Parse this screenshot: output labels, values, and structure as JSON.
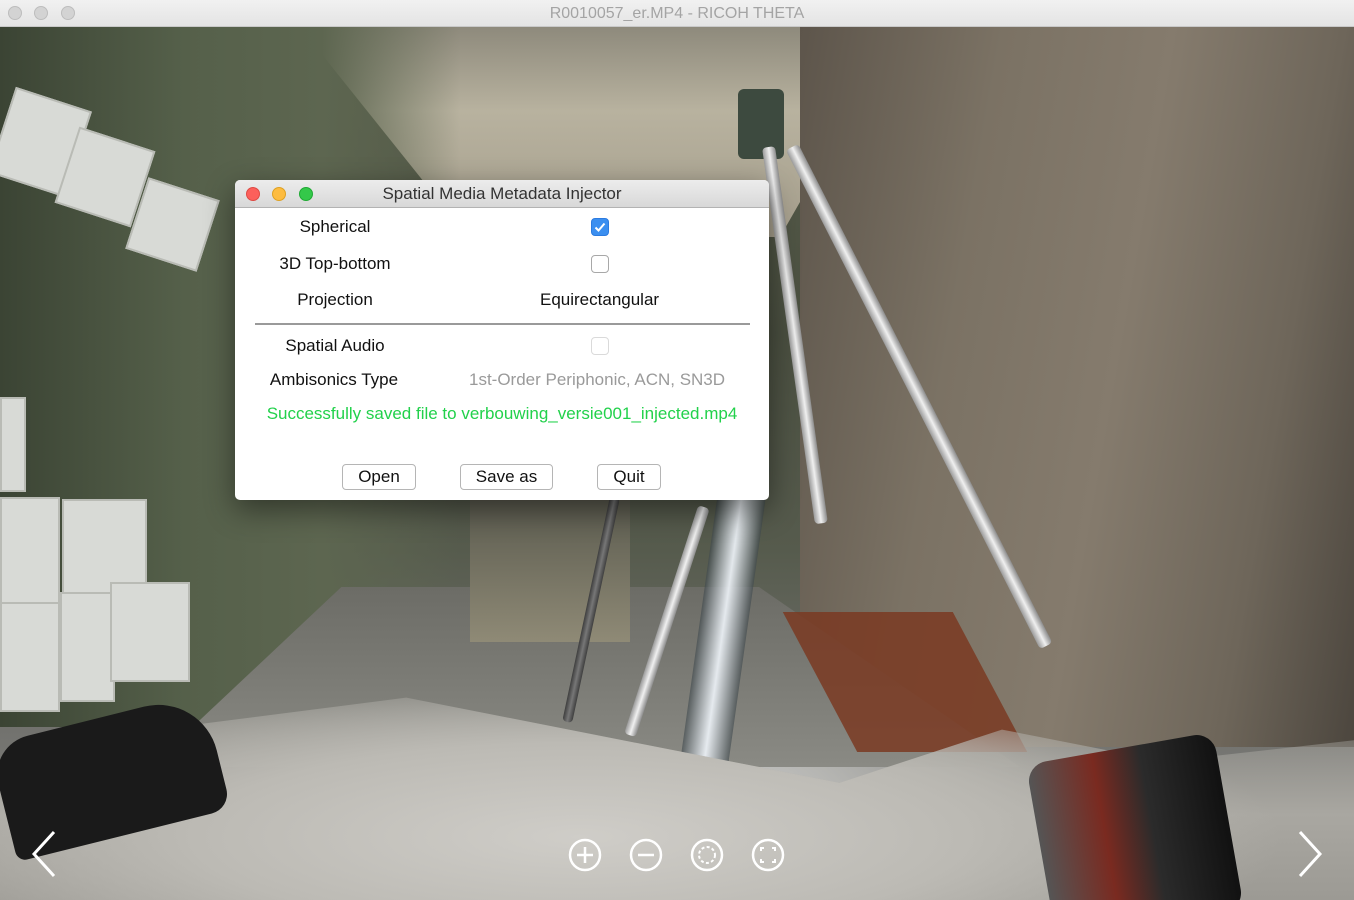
{
  "main_window": {
    "title": "R0010057_er.MP4 - RICOH THETA"
  },
  "viewer_controls": {
    "prev_arrow": "‹",
    "next_arrow": "›",
    "buttons": [
      {
        "icon": "zoom-in-icon"
      },
      {
        "icon": "zoom-out-icon"
      },
      {
        "icon": "view-mode-icon"
      },
      {
        "icon": "fullscreen-icon"
      }
    ]
  },
  "dialog": {
    "title": "Spatial Media Metadata Injector",
    "spherical": {
      "label": "Spherical",
      "checked": true
    },
    "top_bottom": {
      "label": "3D Top-bottom",
      "checked": false
    },
    "projection": {
      "label": "Projection",
      "value": "Equirectangular"
    },
    "spatial_audio": {
      "label": "Spatial Audio",
      "checked": false,
      "enabled": false
    },
    "ambisonics": {
      "label": "Ambisonics Type",
      "value": "1st-Order Periphonic, ACN, SN3D"
    },
    "status_message": "Successfully saved file to verbouwing_versie001_injected.mp4",
    "buttons": {
      "open": "Open",
      "save_as": "Save as",
      "quit": "Quit"
    }
  },
  "colors": {
    "status_text": "#22d14b",
    "checkbox_checked": "#3b8ff0",
    "close_dot": "#fc605b",
    "minimize_dot": "#fdbc40",
    "zoom_dot": "#34c84a"
  }
}
